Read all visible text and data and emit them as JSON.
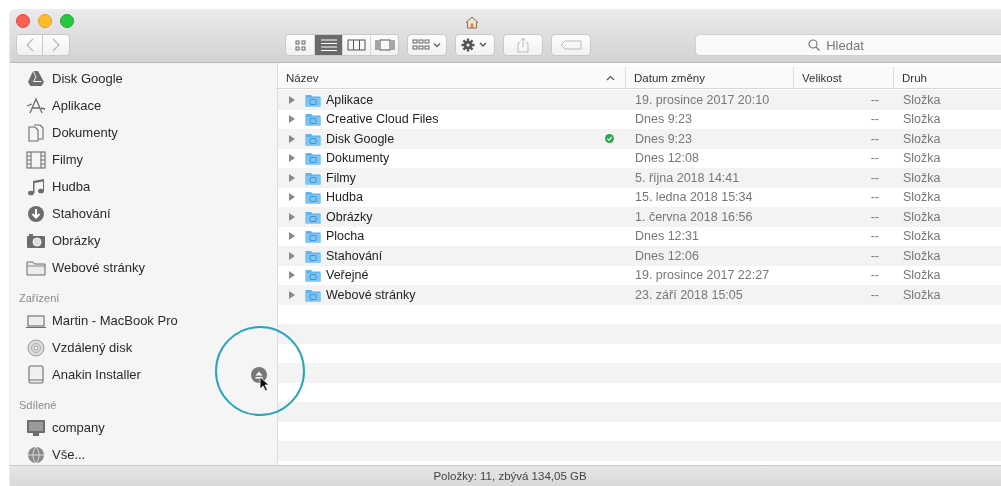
{
  "toolbar": {
    "view_buttons": [
      {
        "selected": false
      },
      {
        "selected": true
      },
      {
        "selected": false
      },
      {
        "selected": false
      }
    ]
  },
  "search": {
    "placeholder": "Hledat"
  },
  "sidebar": {
    "sections": [
      {
        "items": [
          {
            "label": "Disk Google"
          },
          {
            "label": "Aplikace"
          },
          {
            "label": "Dokumenty"
          },
          {
            "label": "Filmy"
          },
          {
            "label": "Hudba"
          },
          {
            "label": "Stahování"
          },
          {
            "label": "Obrázky"
          },
          {
            "label": "Webové stránky"
          }
        ]
      },
      {
        "title": "Zařízení",
        "items": [
          {
            "label": "Martin - MacBook Pro",
            "eject": false
          },
          {
            "label": "Vzdálený disk",
            "eject": false
          },
          {
            "label": "Anakin Installer",
            "eject": true
          }
        ]
      },
      {
        "title": "Sdílené",
        "items": [
          {
            "label": "company"
          },
          {
            "label": "Vše..."
          }
        ]
      }
    ]
  },
  "table": {
    "columns": [
      {
        "label": "Název",
        "sorted": true
      },
      {
        "label": "Datum změny",
        "sorted": false
      },
      {
        "label": "Velikost",
        "sorted": false
      },
      {
        "label": "Druh",
        "sorted": false
      }
    ],
    "rows": [
      {
        "name": "Aplikace",
        "date": "19. prosince 2017 20:10",
        "size": "--",
        "file_type": "Složka",
        "synced": false
      },
      {
        "name": "Creative Cloud Files",
        "date": "Dnes 9:23",
        "size": "--",
        "file_type": "Složka",
        "synced": false
      },
      {
        "name": "Disk Google",
        "date": "Dnes 9:23",
        "size": "--",
        "file_type": "Složka",
        "synced": true
      },
      {
        "name": "Dokumenty",
        "date": "Dnes 12:08",
        "size": "--",
        "file_type": "Složka",
        "synced": false
      },
      {
        "name": "Filmy",
        "date": "5. října 2018 14:41",
        "size": "--",
        "file_type": "Složka",
        "synced": false
      },
      {
        "name": "Hudba",
        "date": "15. ledna 2018 15:34",
        "size": "--",
        "file_type": "Složka",
        "synced": false
      },
      {
        "name": "Obrázky",
        "date": "1. června 2018 16:56",
        "size": "--",
        "file_type": "Složka",
        "synced": false
      },
      {
        "name": "Plocha",
        "date": "Dnes 12:31",
        "size": "--",
        "file_type": "Složka",
        "synced": false
      },
      {
        "name": "Stahování",
        "date": "Dnes 12:06",
        "size": "--",
        "file_type": "Složka",
        "synced": false
      },
      {
        "name": "Veřejné",
        "date": "19. prosince 2017 22:27",
        "size": "--",
        "file_type": "Složka",
        "synced": false
      },
      {
        "name": "Webové stránky",
        "date": "23. září 2018 15:05",
        "size": "--",
        "file_type": "Složka",
        "synced": false
      }
    ]
  },
  "status_bar": "Položky: 11, zbývá 134,05 GB"
}
